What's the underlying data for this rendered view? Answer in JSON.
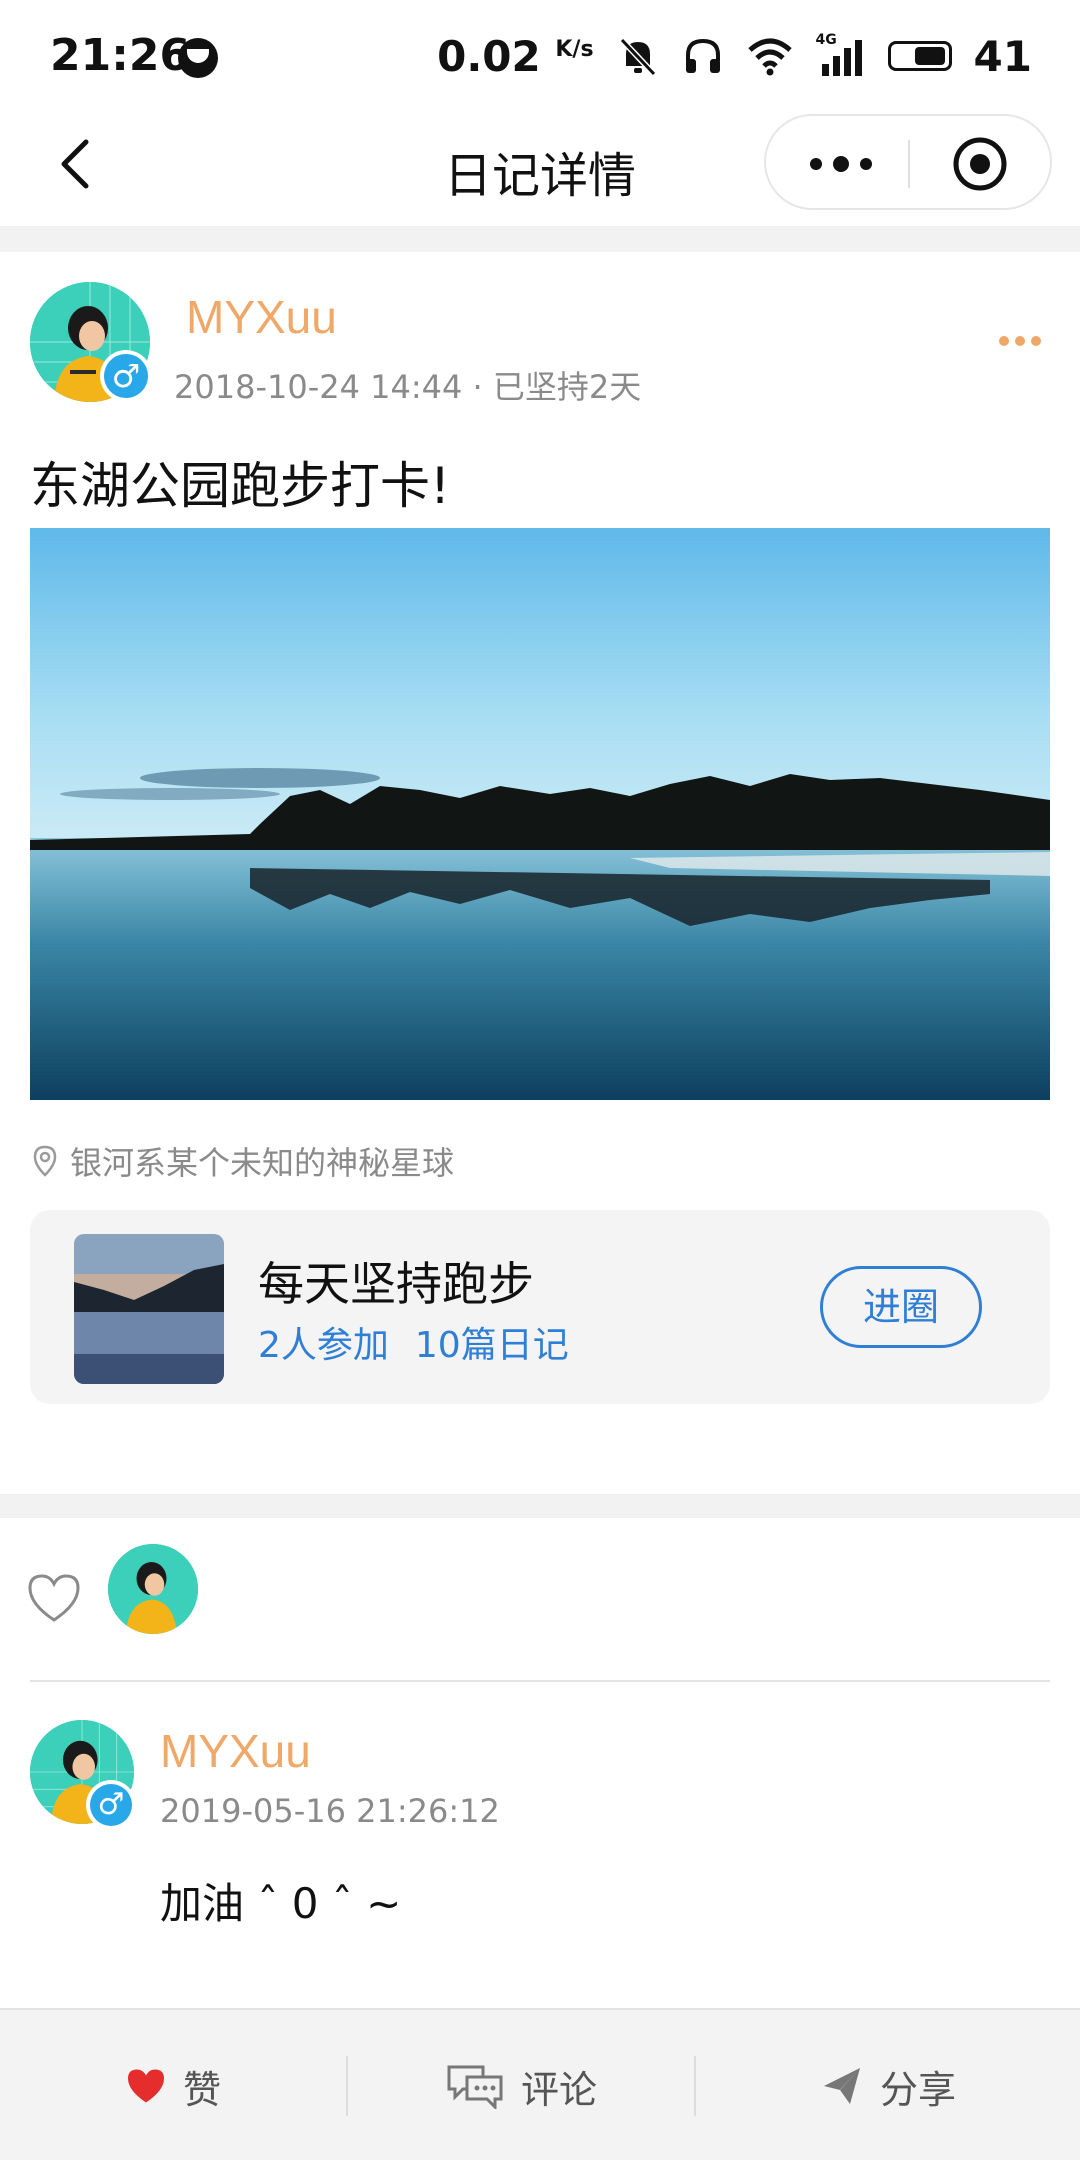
{
  "status_bar": {
    "time": "21:26",
    "net_speed": "0.02",
    "net_speed_unit": "K/s",
    "signal_label": "4G",
    "battery": "41"
  },
  "nav": {
    "title": "日记详情"
  },
  "post": {
    "username": "MYXuu",
    "meta": "2018-10-24 14:44 · 已坚持2天",
    "text": "东湖公园跑步打卡!",
    "location": "银河系某个未知的神秘星球",
    "gender_symbol": "♂"
  },
  "circle": {
    "name": "每天坚持跑步",
    "members": "2人参加",
    "diaries": "10篇日记",
    "join_label": "进圈"
  },
  "comment": {
    "username": "MYXuu",
    "time": "2019-05-16 21:26:12",
    "text": "加油 ˆ 0 ˆ ~"
  },
  "bottom_bar": {
    "like_label": "赞",
    "comment_label": "评论",
    "share_label": "分享"
  },
  "colors": {
    "accent_blue": "#2f7fd6",
    "username_orange": "#f0a868",
    "like_red": "#e52d2d",
    "avatar_teal": "#2ec9b7"
  }
}
